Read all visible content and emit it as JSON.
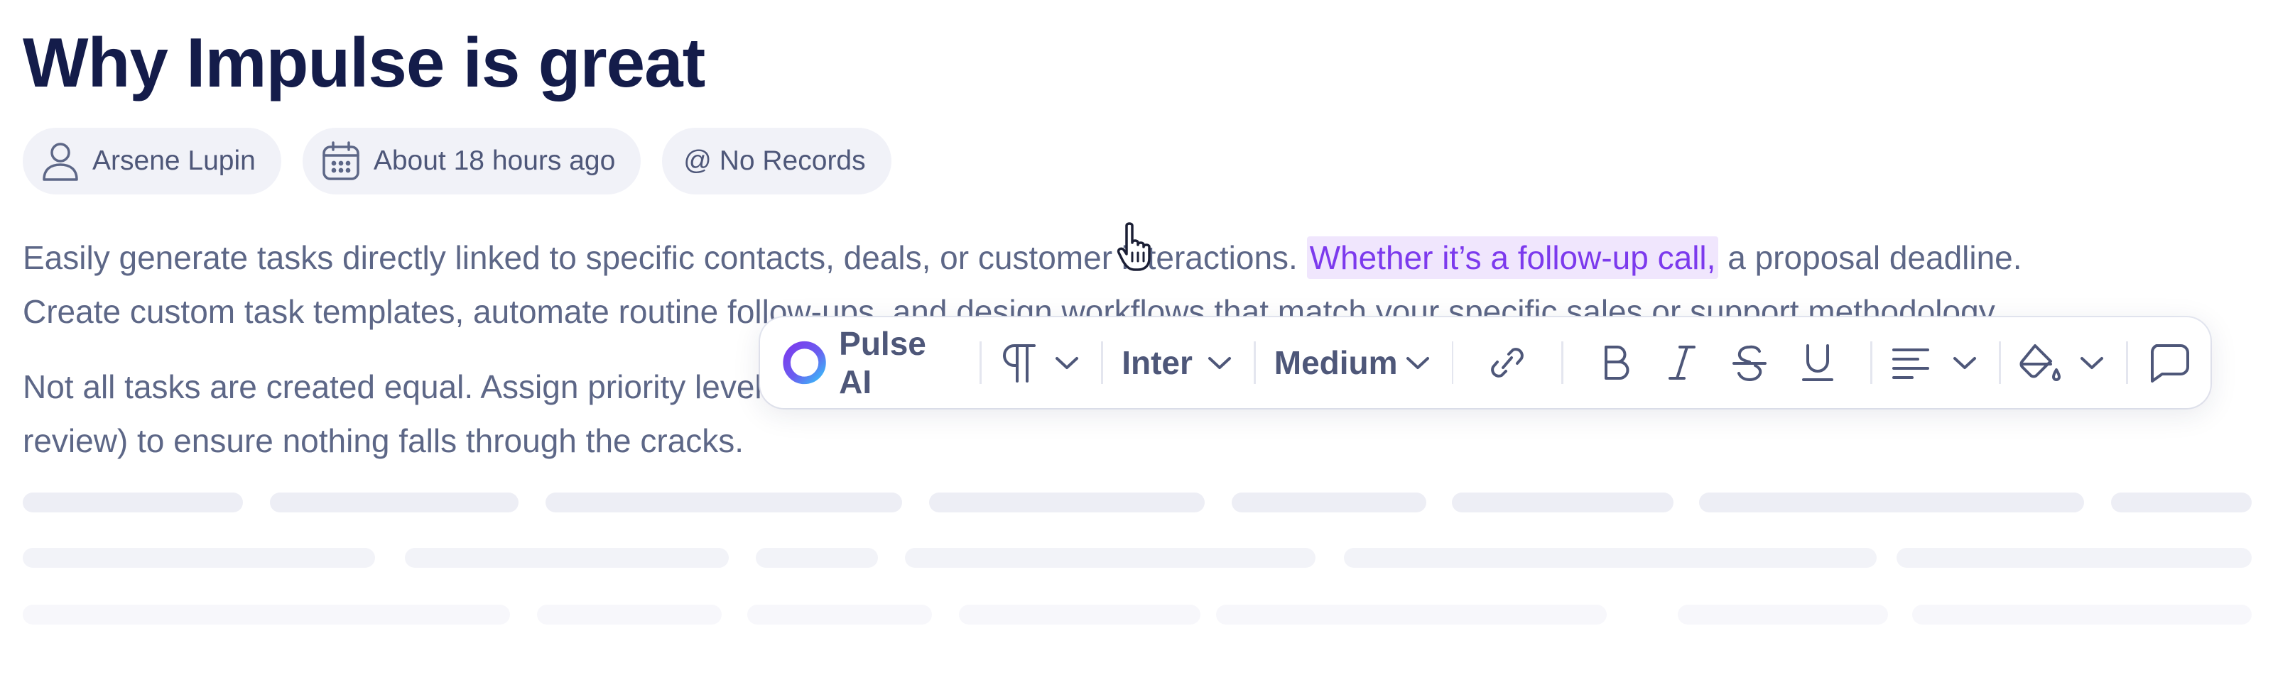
{
  "document": {
    "title": "Why Impulse is great",
    "meta": {
      "author": "Arsene Lupin",
      "time": "About 18 hours ago",
      "records": "@ No Records"
    },
    "paragraph1": {
      "line1_before": "Easily generate tasks directly linked to specific contacts, deals, or customer interactions. ",
      "line1_highlight": "Whether it’s a follow-up call,",
      "line1_after": " a proposal deadline.",
      "line2": "Create custom task templates, automate routine follow-ups, and design workflows that match your specific sales or support methodology."
    },
    "paragraph2": {
      "line1": "Not all tasks are created equal. Assign priority levels",
      "line2": "review) to ensure nothing falls through the cracks."
    }
  },
  "toolbar": {
    "ai_label": "Pulse AI",
    "font_family": "Inter",
    "font_weight": "Medium"
  },
  "colors": {
    "title": "#141c4a",
    "text": "#5d6787",
    "highlight_bg": "#f0e6fd",
    "highlight_text": "#7c3aed",
    "chip_bg": "#f1f2f8",
    "skeleton_1": "#edeef5",
    "skeleton_2": "#f2f3f8",
    "skeleton_3": "#f7f7fb"
  },
  "icons": {
    "author": "user-icon",
    "time": "calendar-icon",
    "ai": "pulse-ai-ring-icon",
    "paragraph": "paragraph-icon",
    "link": "link-icon",
    "bold": "bold-icon",
    "italic": "italic-icon",
    "strike": "strikethrough-icon",
    "underline": "underline-icon",
    "align": "align-left-icon",
    "fill": "paint-bucket-icon",
    "comment": "comment-icon",
    "cursor": "hand-pointer-icon"
  }
}
